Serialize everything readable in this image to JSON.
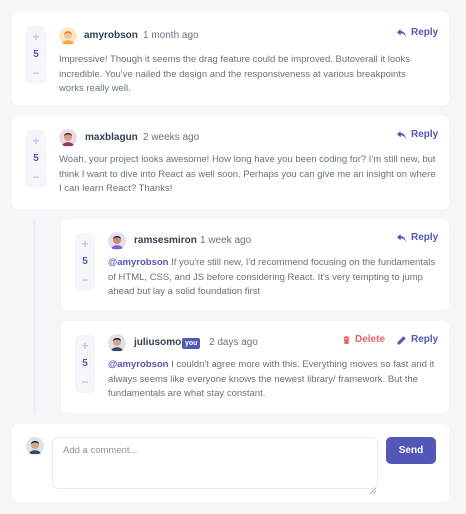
{
  "comments": [
    {
      "username": "amyrobson",
      "time": "1 month ago",
      "score": "5",
      "upvote": "+",
      "downvote": "−",
      "reply_label": "Reply",
      "text": "Impressive! Though it seems the drag feature could be improved. Butoverall it looks incredible. You've nailed the design and the responsiveness at various breakpoints works really well."
    },
    {
      "username": "maxblagun",
      "time": "2 weeks ago",
      "score": "5",
      "upvote": "+",
      "downvote": "−",
      "reply_label": "Reply",
      "text": "Woah, your project looks awesome! How long have you been coding for? I'm still new, but think I want to dive into React as well soon. Perhaps you can give me an insight on where I can learn React? Thanks!"
    }
  ],
  "replies": [
    {
      "username": "ramsesmiron",
      "time": "1 week ago",
      "score": "5",
      "upvote": "+",
      "downvote": "−",
      "reply_label": "Reply",
      "mention": "@amyrobson",
      "text": " If you're still new, I'd recommend focusing on the fundamentals of HTML, CSS, and JS before considering React. It's very tempting to jump ahead but lay a solid foundation first"
    },
    {
      "username": "juliusomo",
      "you_badge": "you",
      "time": "2 days ago",
      "score": "5",
      "upvote": "+",
      "downvote": "−",
      "delete_label": "Delete",
      "edit_label": "Reply",
      "mention": "@amyrobson",
      "text": " I couldn't agree more with this. Everything moves so fast and it always seems like everyone knows the newest library/ framework. But the fundamentals are what stay constant."
    }
  ],
  "new_comment": {
    "placeholder": "Add a comment...",
    "send_label": "Send"
  },
  "icons": {
    "reply": "reply-arrow-icon",
    "delete": "trash-icon",
    "edit": "pencil-icon"
  },
  "colors": {
    "accent": "#5357b6",
    "danger": "#ed6368",
    "vote_button": "#c5c6ef",
    "background": "#f5f6fa",
    "username": "#334253",
    "body_text": "#67727e"
  }
}
